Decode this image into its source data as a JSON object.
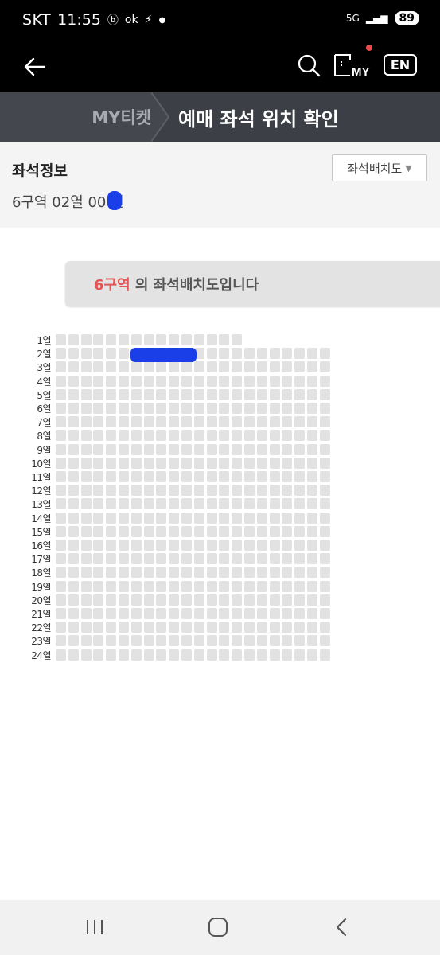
{
  "status_bar": {
    "carrier": "SKT",
    "time": "11:55",
    "ok_label": "ok",
    "network": "5G",
    "battery": "89"
  },
  "app_bar": {
    "my_label": "MY",
    "lang_button": "EN"
  },
  "breadcrumb": {
    "parent": "MY티켓",
    "current": "예매 좌석 위치 확인"
  },
  "seat_info": {
    "title": "좌석정보",
    "value": "6구역 02열 00 번",
    "layout_button": "좌석배치도"
  },
  "banner": {
    "zone": "6구역",
    "suffix": " 의 좌석배치도입니다"
  },
  "seat_map": {
    "row_labels": [
      "1열",
      "2열",
      "3열",
      "4열",
      "5열",
      "6열",
      "7열",
      "8열",
      "9열",
      "10열",
      "11열",
      "12열",
      "13열",
      "14열",
      "15열",
      "16열",
      "17열",
      "18열",
      "19열",
      "20열",
      "21열",
      "22열",
      "23열",
      "24열"
    ],
    "seats_per_row": [
      15,
      22,
      22,
      22,
      22,
      22,
      22,
      22,
      22,
      22,
      22,
      22,
      22,
      22,
      22,
      22,
      22,
      22,
      22,
      22,
      22,
      22,
      22,
      22
    ],
    "seat_color": "#e2e2e2",
    "highlight_color": "#1a3ee8"
  },
  "colors": {
    "header_bg": "#000000",
    "breadcrumb_bg": "#3d3f46",
    "accent_red": "#e55454"
  }
}
